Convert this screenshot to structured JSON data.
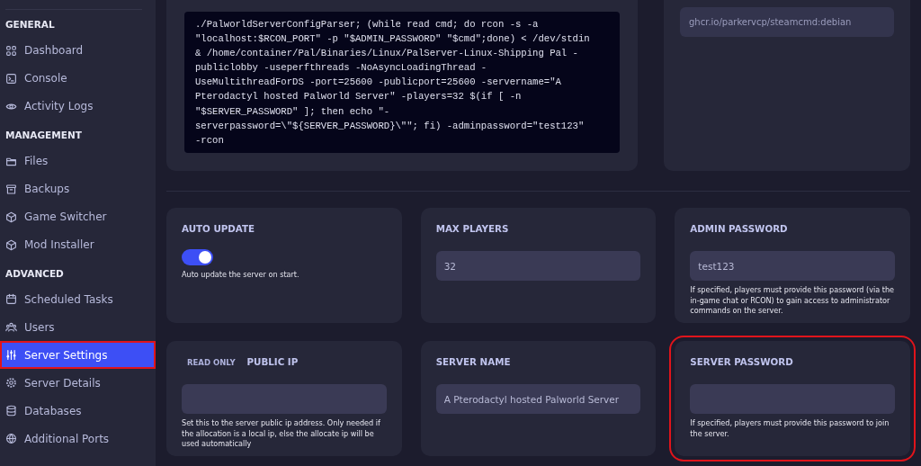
{
  "sidebar": {
    "sections": [
      {
        "title": "GENERAL",
        "items": [
          {
            "label": "Dashboard",
            "selected": false,
            "highlighted": false
          },
          {
            "label": "Console",
            "selected": false,
            "highlighted": false
          },
          {
            "label": "Activity Logs",
            "selected": false,
            "highlighted": false
          }
        ]
      },
      {
        "title": "MANAGEMENT",
        "items": [
          {
            "label": "Files",
            "selected": false,
            "highlighted": false
          },
          {
            "label": "Backups",
            "selected": false,
            "highlighted": false
          },
          {
            "label": "Game Switcher",
            "selected": false,
            "highlighted": false
          },
          {
            "label": "Mod Installer",
            "selected": false,
            "highlighted": false
          }
        ]
      },
      {
        "title": "ADVANCED",
        "items": [
          {
            "label": "Scheduled Tasks",
            "selected": false,
            "highlighted": false
          },
          {
            "label": "Users",
            "selected": false,
            "highlighted": false
          },
          {
            "label": "Server Settings",
            "selected": true,
            "highlighted": true
          },
          {
            "label": "Server Details",
            "selected": false,
            "highlighted": false
          },
          {
            "label": "Databases",
            "selected": false,
            "highlighted": false
          },
          {
            "label": "Additional Ports",
            "selected": false,
            "highlighted": false
          }
        ]
      }
    ]
  },
  "startup": {
    "command_lines": [
      "./PalworldServerConfigParser; (while read cmd; do rcon -s -a",
      "\"localhost:$RCON_PORT\" -p \"$ADMIN_PASSWORD\" \"$cmd\";done) < /dev/stdin",
      "& /home/container/Pal/Binaries/Linux/PalServer-Linux-Shipping Pal -",
      "publiclobby -useperfthreads -NoAsyncLoadingThread -",
      "UseMultithreadForDS -port=25600 -publicport=25600 -servername=\"A",
      "Pterodactyl hosted Palworld Server\" -players=32 $(if [ -n",
      "\"$SERVER_PASSWORD\" ]; then echo \"-",
      "serverpassword=\\\"${SERVER_PASSWORD}\\\"\"; fi) -adminpassword=\"test123\"",
      "-rcon"
    ]
  },
  "docker_image": {
    "value": "ghcr.io/parkervcp/steamcmd:debian"
  },
  "variables": [
    {
      "kind": "toggle",
      "title": "AUTO UPDATE",
      "on": true,
      "description": "Auto update the server on start.",
      "highlighted": false
    },
    {
      "kind": "input",
      "title": "MAX PLAYERS",
      "value": "32",
      "highlighted": false
    },
    {
      "kind": "input",
      "title": "ADMIN PASSWORD",
      "value": "test123",
      "description": "If specified, players must provide this password (via the in-game chat or RCON) to gain access to administrator commands on the server.",
      "highlighted": false
    },
    {
      "kind": "input",
      "badge": "READ ONLY",
      "title": "PUBLIC IP",
      "description": "Set this to the server public ip address. Only needed if the allocation is a local ip, else the allocate ip will be used automatically",
      "highlighted": false
    },
    {
      "kind": "input",
      "title": "SERVER NAME",
      "value": "A Pterodactyl hosted Palworld Server",
      "highlighted": false
    },
    {
      "kind": "input",
      "title": "SERVER PASSWORD",
      "description": "If specified, players must provide this password to join the server.",
      "highlighted": true
    }
  ]
}
